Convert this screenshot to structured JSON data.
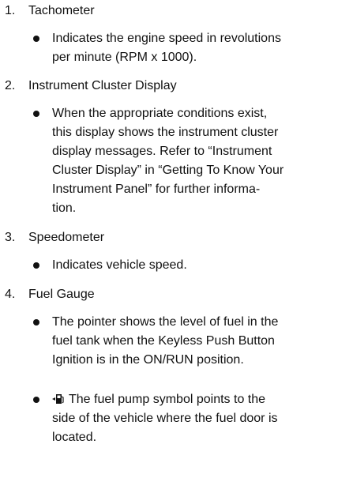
{
  "sections": [
    {
      "number": "1.",
      "title": "Tachometer",
      "bullets": [
        {
          "lines": [
            "Indicates the engine speed in revolutions",
            "per minute (RPM x 1000)."
          ]
        }
      ]
    },
    {
      "number": "2.",
      "title": "Instrument Cluster Display",
      "bullets": [
        {
          "lines": [
            "When the appropriate conditions exist,",
            "this display shows the instrument cluster",
            "display messages. Refer to “Instrument",
            "Cluster Display” in “Getting To Know Your",
            "Instrument Panel” for further informa-",
            "tion."
          ]
        }
      ]
    },
    {
      "number": "3.",
      "title": "Speedometer",
      "bullets": [
        {
          "lines": [
            "Indicates vehicle speed."
          ]
        }
      ]
    },
    {
      "number": "4.",
      "title": "Fuel Gauge",
      "bullets": [
        {
          "lines": [
            "The pointer shows the level of fuel in the",
            "fuel tank when the Keyless Push Button",
            "Ignition is in the ON/RUN position."
          ]
        },
        {
          "icon": "fuel-pump-icon",
          "lines": [
            "The fuel pump symbol points to the",
            "side of the vehicle where the fuel door is",
            "located."
          ]
        }
      ]
    }
  ]
}
